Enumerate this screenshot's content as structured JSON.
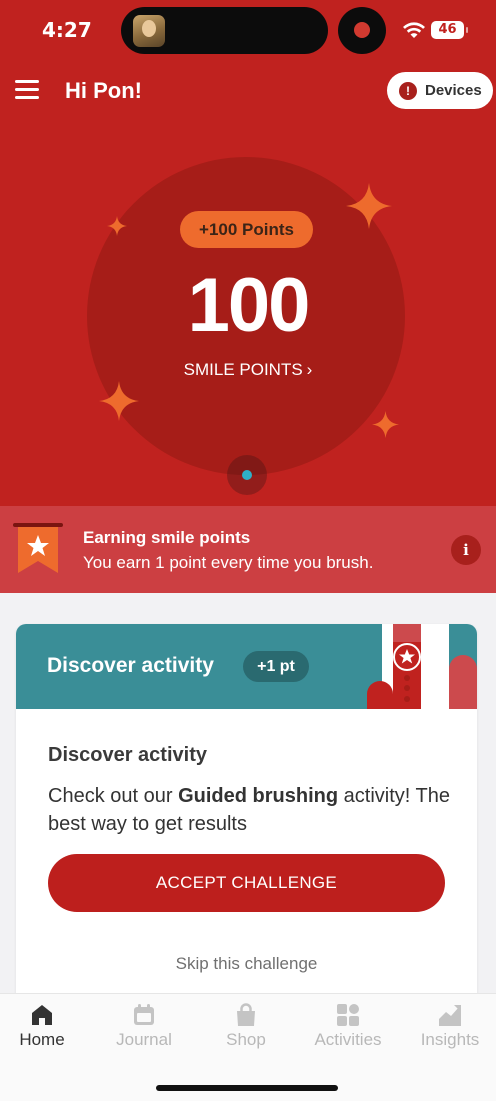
{
  "status_bar": {
    "time": "4:27",
    "battery": "46"
  },
  "header": {
    "greeting": "Hi Pon!",
    "devices_label": "Devices",
    "alert_glyph": "!"
  },
  "points": {
    "badge": "+100 Points",
    "value": "100",
    "link_label": "SMILE POINTS",
    "link_chevron": "›"
  },
  "banner": {
    "title": "Earning smile points",
    "text": "You earn 1 point every time you brush.",
    "info_glyph": "i"
  },
  "card": {
    "header_title": "Discover activity",
    "points_badge": "+1 pt",
    "title": "Discover activity",
    "body_prefix": "Check out our ",
    "body_bold": "Guided brushing",
    "body_suffix": " activity! The best way to get results",
    "accept_label": "ACCEPT CHALLENGE",
    "skip_label": "Skip this challenge"
  },
  "tabs": [
    {
      "label": "Home",
      "icon": "home-icon",
      "active": true
    },
    {
      "label": "Journal",
      "icon": "calendar-icon",
      "active": false
    },
    {
      "label": "Shop",
      "icon": "shopping-bag-icon",
      "active": false
    },
    {
      "label": "Activities",
      "icon": "grid-icon",
      "active": false
    },
    {
      "label": "Insights",
      "icon": "chart-icon",
      "active": false
    }
  ],
  "colors": {
    "brand_red": "#c0221f",
    "circle_red": "#a61d18",
    "accent_orange": "#ee6b2d",
    "banner_red": "#cc3f42",
    "teal": "#3a8e97",
    "button_red": "#bd1f1d"
  }
}
